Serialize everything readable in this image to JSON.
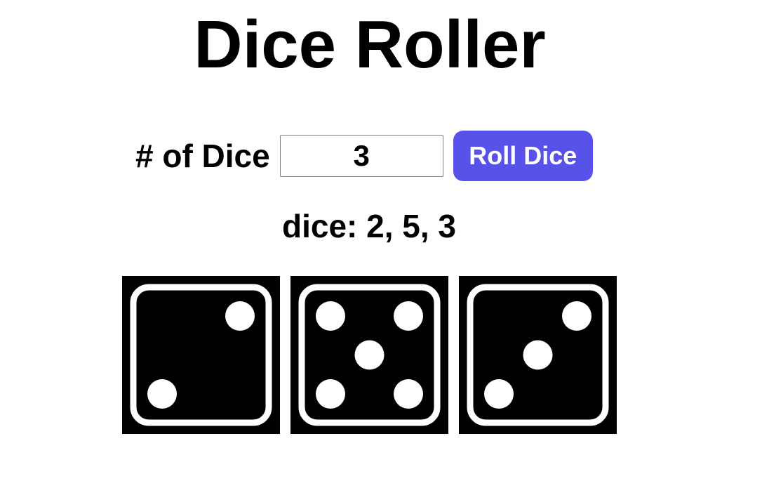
{
  "title": "Dice Roller",
  "controls": {
    "count_label": "# of Dice",
    "count_value": "3",
    "roll_button_label": "Roll Dice",
    "roll_button_color": "#5851ea"
  },
  "result": {
    "text": "dice: 2, 5, 3"
  },
  "dice": [
    {
      "face": 2,
      "icon": "die-face-2-icon"
    },
    {
      "face": 5,
      "icon": "die-face-5-icon"
    },
    {
      "face": 3,
      "icon": "die-face-3-icon"
    }
  ],
  "colors": {
    "die_background": "#000000",
    "die_border_and_pips": "#ffffff"
  }
}
